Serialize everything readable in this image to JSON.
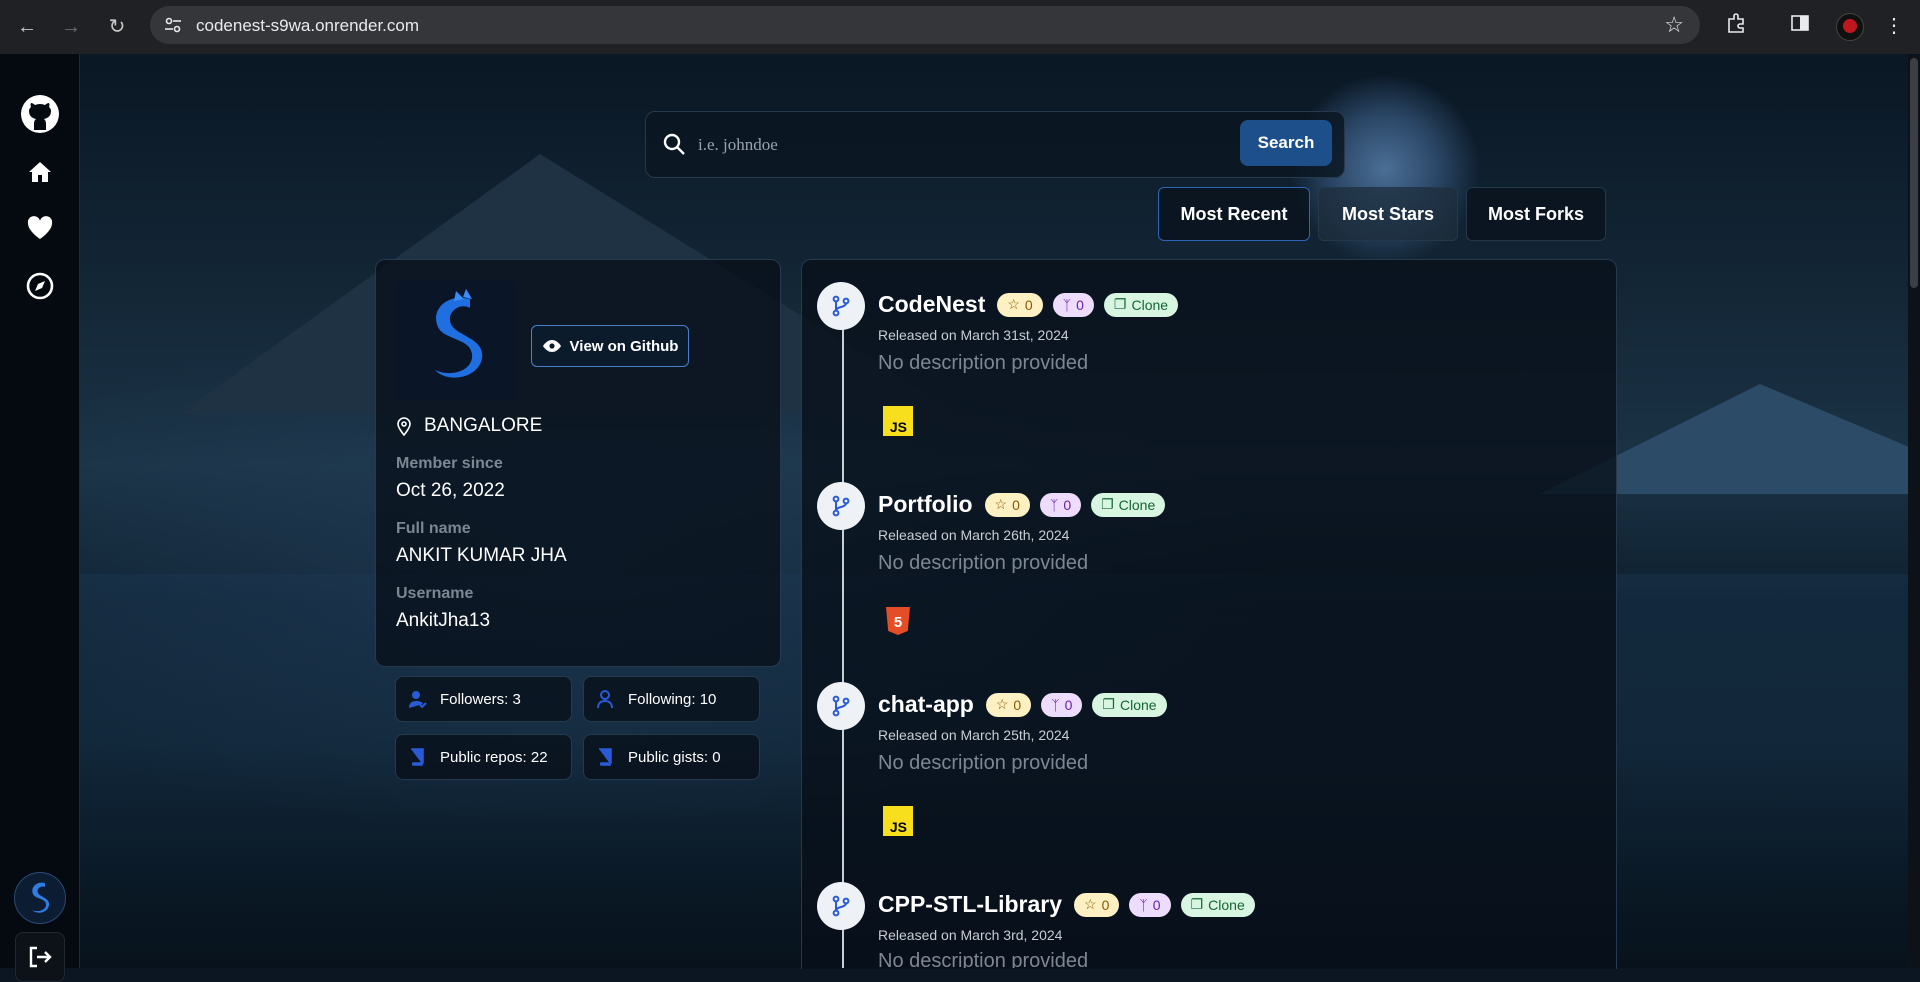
{
  "browser": {
    "url": "codenest-s9wa.onrender.com"
  },
  "search": {
    "placeholder": "i.e. johndoe",
    "button_label": "Search"
  },
  "sort": {
    "options": [
      "Most Recent",
      "Most Stars",
      "Most Forks"
    ],
    "active": "Most Recent"
  },
  "profile": {
    "view_label": "View on Github",
    "location": "BANGALORE",
    "member_since_label": "Member since",
    "member_since": "Oct 26, 2022",
    "full_name_label": "Full name",
    "full_name": "ANKIT KUMAR JHA",
    "username_label": "Username",
    "username": "AnkitJha13"
  },
  "stats": {
    "followers": "Followers: 3",
    "following": "Following: 10",
    "public_repos": "Public repos: 22",
    "public_gists": "Public gists: 0"
  },
  "colors": {
    "accent": "#1d4f8a",
    "star_badge": "#fdf0c2",
    "fork_badge": "#eddcfb",
    "clone_badge": "#d8f5e2"
  },
  "repos": [
    {
      "name": "CodeNest",
      "stars": "0",
      "forks": "0",
      "clone_label": "Clone",
      "released": "Released on March 31st, 2024",
      "description": "No description provided",
      "language_icon": "javascript-icon",
      "lang_text": "JS"
    },
    {
      "name": "Portfolio",
      "stars": "0",
      "forks": "0",
      "clone_label": "Clone",
      "released": "Released on March 26th, 2024",
      "description": "No description provided",
      "language_icon": "html5-icon",
      "lang_text": "5"
    },
    {
      "name": "chat-app",
      "stars": "0",
      "forks": "0",
      "clone_label": "Clone",
      "released": "Released on March 25th, 2024",
      "description": "No description provided",
      "language_icon": "javascript-icon",
      "lang_text": "JS"
    },
    {
      "name": "CPP-STL-Library",
      "stars": "0",
      "forks": "0",
      "clone_label": "Clone",
      "released": "Released on March 3rd, 2024",
      "description": "No description provided",
      "language_icon": "",
      "lang_text": ""
    }
  ]
}
